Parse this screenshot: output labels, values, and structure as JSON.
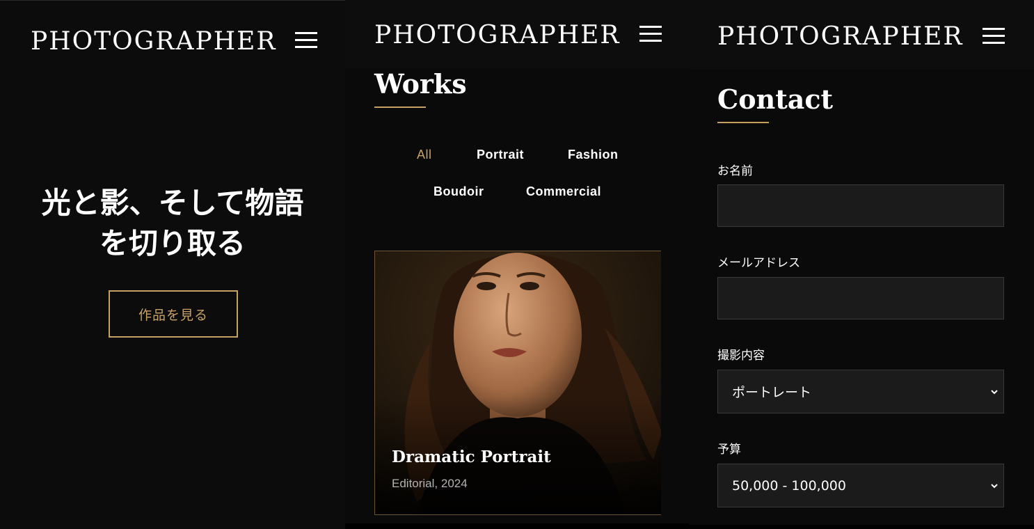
{
  "brand": {
    "logo": "PHOTOGRAPHER"
  },
  "hero": {
    "title_line1": "光と影、そして物語",
    "title_line2": "を切り取る",
    "cta": "作品を見る"
  },
  "works": {
    "title": "Works",
    "filters": [
      {
        "label": "All",
        "active": true
      },
      {
        "label": "Portrait",
        "active": false
      },
      {
        "label": "Fashion",
        "active": false
      },
      {
        "label": "Boudoir",
        "active": false
      },
      {
        "label": "Commercial",
        "active": false
      }
    ],
    "card": {
      "title": "Dramatic Portrait",
      "subtitle": "Editorial, 2024"
    }
  },
  "contact": {
    "title": "Contact",
    "fields": {
      "name_label": "お名前",
      "email_label": "メールアドレス",
      "type_label": "撮影内容",
      "type_value": "ポートレート",
      "budget_label": "予算",
      "budget_value": "50,000 - 100,000"
    }
  },
  "colors": {
    "accent": "#c8a165",
    "background": "#0c0c0c",
    "field": "#1b1b1b"
  },
  "icons": {
    "menu": "hamburger-menu-icon",
    "select": "chevron-down-icon"
  }
}
